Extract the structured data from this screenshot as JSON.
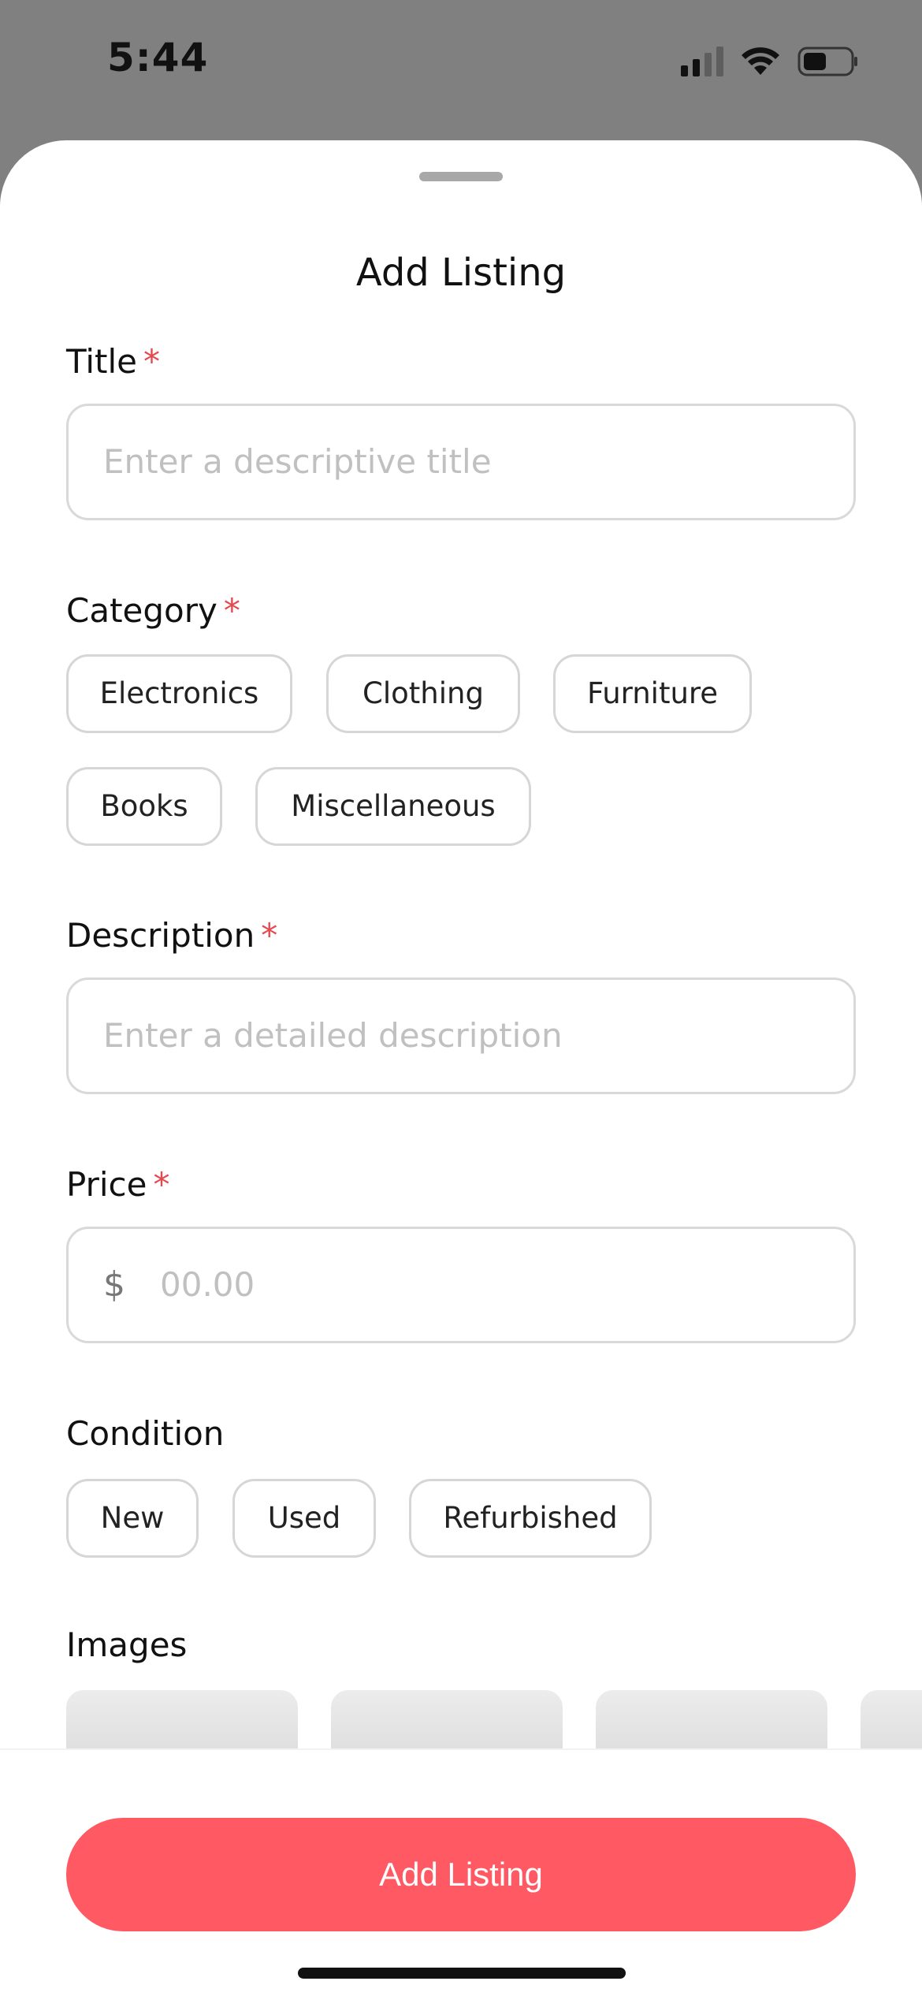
{
  "status_bar": {
    "time": "5:44"
  },
  "sheet": {
    "title": "Add Listing"
  },
  "form": {
    "title": {
      "label": "Title",
      "required_mark": "*",
      "placeholder": "Enter a descriptive title"
    },
    "category": {
      "label": "Category",
      "required_mark": "*",
      "options": [
        "Electronics",
        "Clothing",
        "Furniture",
        "Books",
        "Miscellaneous"
      ]
    },
    "description": {
      "label": "Description",
      "required_mark": "*",
      "placeholder": "Enter a detailed description"
    },
    "price": {
      "label": "Price",
      "required_mark": "*",
      "currency": "$",
      "placeholder": "00.00"
    },
    "condition": {
      "label": "Condition",
      "options": [
        "New",
        "Used",
        "Refurbished"
      ]
    },
    "images": {
      "label": "Images"
    }
  },
  "actions": {
    "submit_label": "Add Listing"
  },
  "colors": {
    "accent": "#ff5a63",
    "required": "#e5484d",
    "overlay": "#808080"
  }
}
